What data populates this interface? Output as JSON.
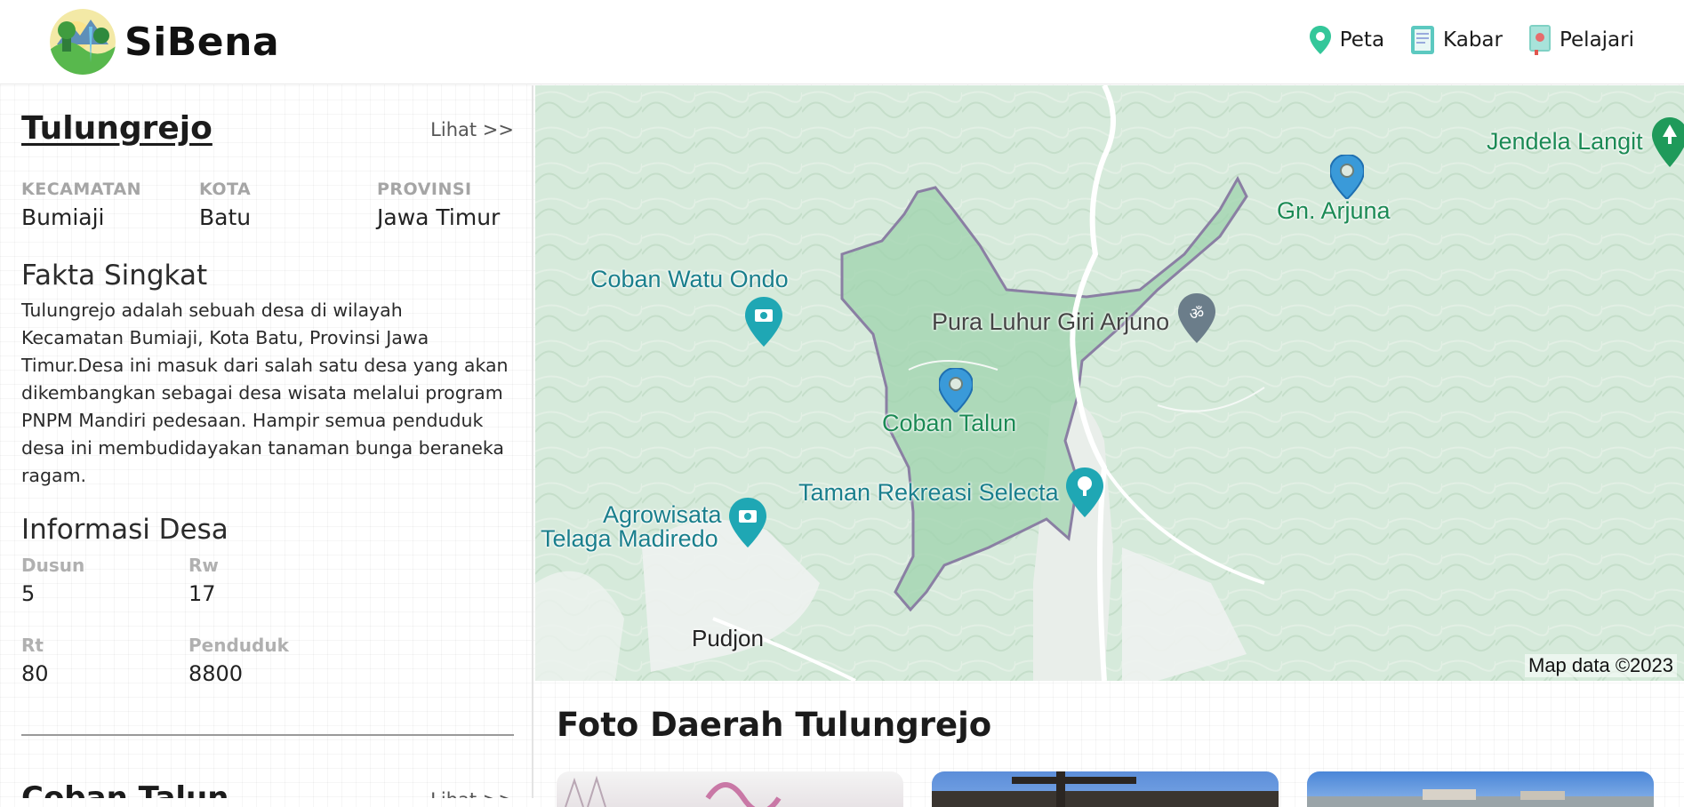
{
  "app": {
    "name": "SiBena"
  },
  "nav": {
    "items": [
      {
        "label": "Peta",
        "icon": "map-pin-icon"
      },
      {
        "label": "Kabar",
        "icon": "newspaper-icon"
      },
      {
        "label": "Pelajari",
        "icon": "book-icon"
      }
    ]
  },
  "sidebar": {
    "village": {
      "name": "Tulungrejo",
      "see_link": "Lihat >>",
      "kecamatan_label": "KECAMATAN",
      "kecamatan": "Bumiaji",
      "kota_label": "KOTA",
      "kota": "Batu",
      "provinsi_label": "PROVINSI",
      "provinsi": "Jawa Timur"
    },
    "fakta": {
      "title": "Fakta Singkat",
      "text": "Tulungrejo adalah sebuah desa di wilayah Kecamatan Bumiaji, Kota Batu, Provinsi Jawa Timur.Desa ini masuk dari salah satu desa yang akan dikembangkan sebagai desa wisata melalui program PNPM Mandiri pedesaan. Hampir semua penduduk desa ini membudidayakan tanaman bunga beraneka ragam."
    },
    "info": {
      "title": "Informasi Desa",
      "dusun_label": "Dusun",
      "dusun": "5",
      "rw_label": "Rw",
      "rw": "17",
      "rt_label": "Rt",
      "rt": "80",
      "penduduk_label": "Penduduk",
      "penduduk": "8800"
    },
    "next": {
      "name": "Coban Talun",
      "see_link": "Lihat >>"
    }
  },
  "map": {
    "labels": {
      "jendela": "Jendela Langit",
      "arjuna": "Gn. Arjuna",
      "watu_ondo": "Coban Watu Ondo",
      "pura": "Pura Luhur Giri Arjuno",
      "coban_talun": "Coban Talun",
      "selecta": "Taman Rekreasi Selecta",
      "agro1": "Agrowisata",
      "agro2": "Telaga Madiredo",
      "pujon": "Pudjon"
    },
    "attribution": "Map data ©2023"
  },
  "photos": {
    "title": "Foto Daerah Tulungrejo"
  },
  "colors": {
    "accent": "#3a9ad9",
    "pin_green": "#34c79a",
    "polygon": "#8a7fa3"
  }
}
